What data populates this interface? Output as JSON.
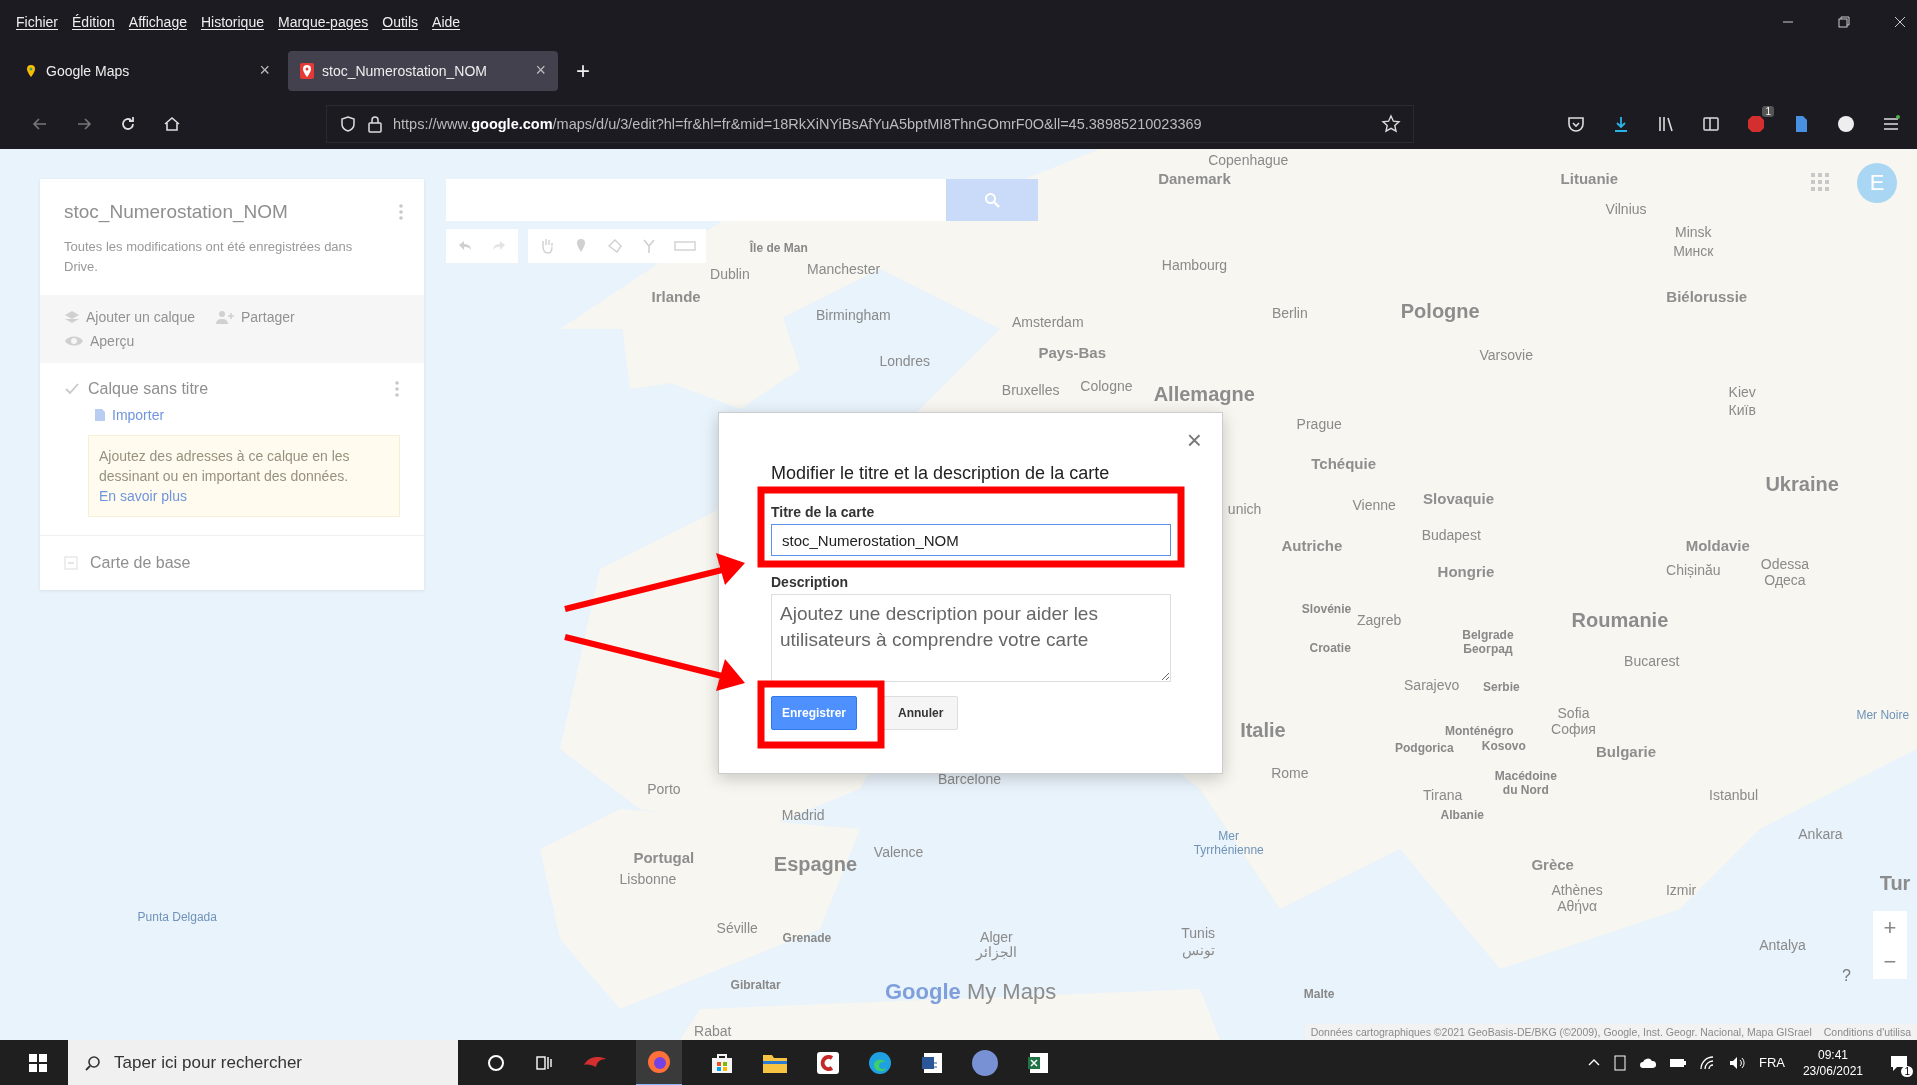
{
  "browser": {
    "menu": [
      "Fichier",
      "Édition",
      "Affichage",
      "Historique",
      "Marque-pages",
      "Outils",
      "Aide"
    ],
    "tabs": [
      {
        "title": "Google Maps",
        "selected": false,
        "close": "×"
      },
      {
        "title": "stoc_Numerostation_NOM",
        "selected": true,
        "close": "×"
      }
    ],
    "new_tab": "+",
    "url": "https://www.**google.com**/maps/d/u/3/edit?hl=fr&hl=fr&mid=18RkXiNYiBsAfYuA5bptMI8ThnGOmrF0O&ll=45.38985210023369",
    "extension_badge": "1"
  },
  "panel": {
    "title": "stoc_Numerostation_NOM",
    "status": "Toutes les modifications ont été enregistrées dans Drive.",
    "add_layer": "Ajouter un calque",
    "share": "Partager",
    "preview": "Aperçu",
    "layer": {
      "name": "Calque sans titre",
      "checked": true,
      "import": "Importer",
      "hint": "Ajoutez des adresses à ce calque en les dessinant ou en important des données.",
      "hint_link": "En savoir plus"
    },
    "base_map": "Carte de base"
  },
  "avatar": "E",
  "map": {
    "labels": [
      {
        "text": "Copenhague",
        "kind": "city"
      },
      {
        "text": "Danemark",
        "kind": "region"
      },
      {
        "text": "Lituanie",
        "kind": "region"
      },
      {
        "text": "Vilnius",
        "kind": "city"
      },
      {
        "text": "Minsk",
        "kind": "city"
      },
      {
        "text": "Île de Man",
        "kind": "small"
      },
      {
        "text": "Минск",
        "kind": "city"
      },
      {
        "text": "Dublin",
        "kind": "city"
      },
      {
        "text": "Manchester",
        "kind": "city"
      },
      {
        "text": "Hambourg",
        "kind": "city"
      },
      {
        "text": "Irlande",
        "kind": "region"
      },
      {
        "text": "Biélorussie",
        "kind": "region"
      },
      {
        "text": "Birmingham",
        "kind": "city"
      },
      {
        "text": "Amsterdam",
        "kind": "city"
      },
      {
        "text": "Berlin",
        "kind": "city"
      },
      {
        "text": "Pologne",
        "kind": "country"
      },
      {
        "text": "Londres",
        "kind": "city"
      },
      {
        "text": "Pays-Bas",
        "kind": "region"
      },
      {
        "text": "Varsovie",
        "kind": "city"
      },
      {
        "text": "Bruxelles",
        "kind": "city"
      },
      {
        "text": "Cologne",
        "kind": "city"
      },
      {
        "text": "Allemagne",
        "kind": "country"
      },
      {
        "text": "Kiev",
        "kind": "city"
      },
      {
        "text": "Київ",
        "kind": "city"
      },
      {
        "text": "Prague",
        "kind": "city"
      },
      {
        "text": "Tchéquie",
        "kind": "region"
      },
      {
        "text": "Ukraine",
        "kind": "country"
      },
      {
        "text": "unich",
        "kind": "city"
      },
      {
        "text": "Vienne",
        "kind": "city"
      },
      {
        "text": "Slovaquie",
        "kind": "region"
      },
      {
        "text": "Autriche",
        "kind": "region"
      },
      {
        "text": "Budapest",
        "kind": "city"
      },
      {
        "text": "Moldavie",
        "kind": "region"
      },
      {
        "text": "Hongrie",
        "kind": "region"
      },
      {
        "text": "Chișinău",
        "kind": "city"
      },
      {
        "text": "Odessa",
        "kind": "city"
      },
      {
        "text": "Одеса",
        "kind": "city"
      },
      {
        "text": "Slovénie",
        "kind": "small"
      },
      {
        "text": "Zagreb",
        "kind": "city"
      },
      {
        "text": "Roumanie",
        "kind": "country"
      },
      {
        "text": "Belgrade",
        "kind": "small"
      },
      {
        "text": "Croatie",
        "kind": "small"
      },
      {
        "text": "Београд",
        "kind": "small"
      },
      {
        "text": "Bucarest",
        "kind": "city"
      },
      {
        "text": "Sarajevo",
        "kind": "city"
      },
      {
        "text": "Serbie",
        "kind": "small"
      },
      {
        "text": "Sofia",
        "kind": "city"
      },
      {
        "text": "Mer Noire",
        "kind": "sea"
      },
      {
        "text": "Italie",
        "kind": "country"
      },
      {
        "text": "Monténégro",
        "kind": "small"
      },
      {
        "text": "София",
        "kind": "city"
      },
      {
        "text": "Podgorica",
        "kind": "small"
      },
      {
        "text": "Kosovo",
        "kind": "small"
      },
      {
        "text": "Bulgarie",
        "kind": "region"
      },
      {
        "text": "Barcelone",
        "kind": "city"
      },
      {
        "text": "Rome",
        "kind": "city"
      },
      {
        "text": "Macédoine",
        "kind": "small"
      },
      {
        "text": "Porto",
        "kind": "city"
      },
      {
        "text": "du Nord",
        "kind": "small"
      },
      {
        "text": "Tirana",
        "kind": "city"
      },
      {
        "text": "Istanbul",
        "kind": "city"
      },
      {
        "text": "Madrid",
        "kind": "city"
      },
      {
        "text": "Albanie",
        "kind": "small"
      },
      {
        "text": "Mer",
        "kind": "sea"
      },
      {
        "text": "Ankara",
        "kind": "city"
      },
      {
        "text": "Portugal",
        "kind": "region"
      },
      {
        "text": "Valence",
        "kind": "city"
      },
      {
        "text": "Tyrrhénienne",
        "kind": "sea"
      },
      {
        "text": "Espagne",
        "kind": "country"
      },
      {
        "text": "Grèce",
        "kind": "region"
      },
      {
        "text": "Lisbonne",
        "kind": "city"
      },
      {
        "text": "Tur",
        "kind": "country"
      },
      {
        "text": "Athènes",
        "kind": "city"
      },
      {
        "text": "Izmir",
        "kind": "city"
      },
      {
        "text": "Αθήνα",
        "kind": "city"
      },
      {
        "text": "Punta Delgada",
        "kind": "sea"
      },
      {
        "text": "Séville",
        "kind": "city"
      },
      {
        "text": "Grenade",
        "kind": "small"
      },
      {
        "text": "Alger",
        "kind": "city"
      },
      {
        "text": "Tunis",
        "kind": "city"
      },
      {
        "text": "الجزائر",
        "kind": "city"
      },
      {
        "text": "تونس",
        "kind": "city"
      },
      {
        "text": "Antalya",
        "kind": "city"
      },
      {
        "text": "Gibraltar",
        "kind": "small"
      },
      {
        "text": "Malte",
        "kind": "small"
      },
      {
        "text": "Rabat",
        "kind": "city"
      }
    ],
    "logo_brand": "Google",
    "logo_product": "My Maps",
    "attribution": "Données cartographiques ©2021 GeoBasis-DE/BKG (©2009), Google, Inst. Geogr. Nacional, Mapa GISrael",
    "terms": "Conditions d'utilisa",
    "zoom_in": "+",
    "zoom_out": "−",
    "help": "?"
  },
  "dialog": {
    "title": "Modifier le titre et la description de la carte",
    "close": "×",
    "title_label": "Titre de la carte",
    "title_value": "stoc_Numerostation_NOM",
    "description_label": "Description",
    "description_placeholder": "Ajoutez une description pour aider les utilisateurs à comprendre votre carte",
    "save": "Enregistrer",
    "cancel": "Annuler"
  },
  "taskbar": {
    "search_placeholder": "Taper ici pour rechercher",
    "language": "FRA",
    "time": "09:41",
    "date": "23/06/2021",
    "notification_count": "1"
  }
}
